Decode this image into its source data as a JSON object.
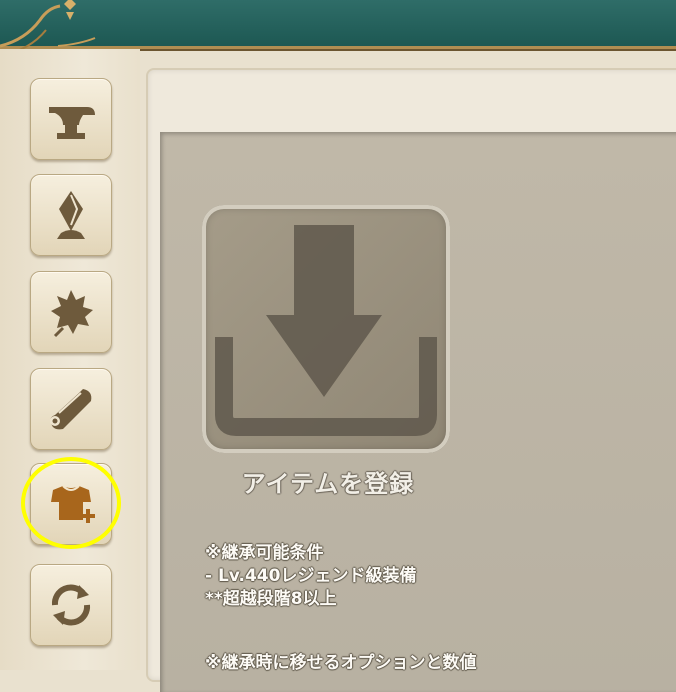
{
  "sidebar": {
    "items": [
      {
        "icon": "anvil-icon"
      },
      {
        "icon": "crystal-icon"
      },
      {
        "icon": "leaf-icon"
      },
      {
        "icon": "scroll-icon"
      },
      {
        "icon": "armor-plus-icon",
        "selected": true
      },
      {
        "icon": "refresh-icon"
      }
    ]
  },
  "main": {
    "register_label": "アイテムを登録",
    "conditions": {
      "title": "※継承可能条件",
      "line1": "- Lv.440レジェンド級装備",
      "line2": "**超越段階8以上"
    },
    "options_title": "※継承時に移せるオプションと数値"
  },
  "colors": {
    "topbar": "#1d5853",
    "highlight": "#ffff00",
    "icon_brown": "#6e5a3c",
    "selected_icon": "#a8661c"
  }
}
